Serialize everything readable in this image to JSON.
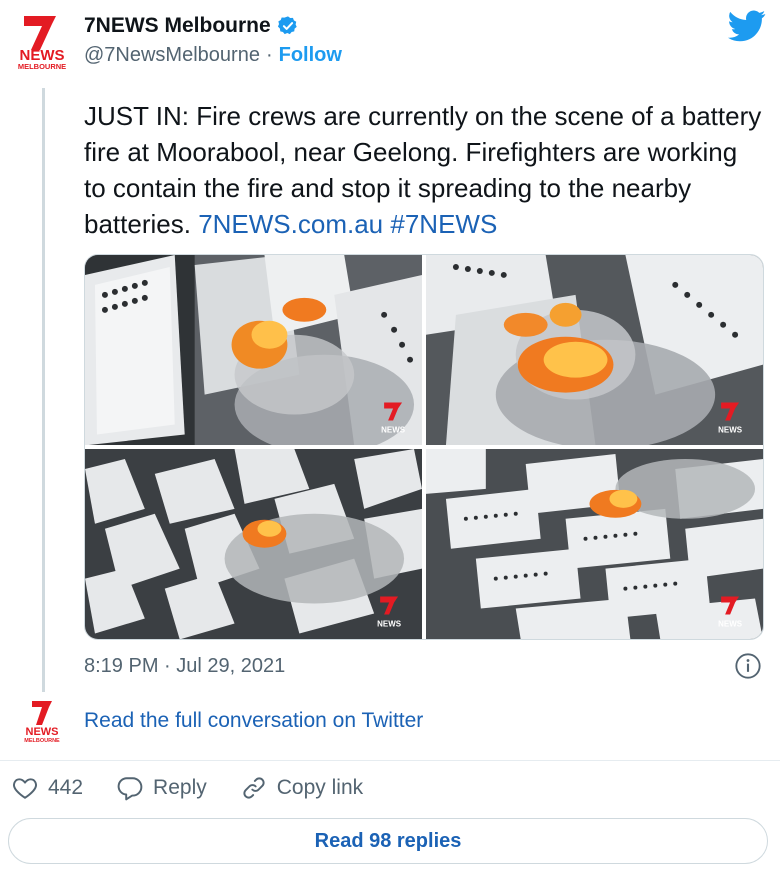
{
  "author": {
    "name": "7NEWS Melbourne",
    "handle": "@7NewsMelbourne",
    "separator": "·",
    "follow_label": "Follow",
    "logo_text_top": "NEWS",
    "logo_text_bottom": "MELBOURNE",
    "logo_digit": "7"
  },
  "tweet": {
    "text": "JUST IN: Fire crews are currently on the scene of a battery fire at Moorabool, near Geelong. Firefighters are working to contain the fire and stop it spreading to the nearby batteries.",
    "link": "7NEWS.com.au",
    "hashtag": "#7NEWS",
    "timestamp": "8:19 PM · Jul 29, 2021"
  },
  "media": {
    "watermark": "NEWS",
    "images": [
      {
        "name": "fire-photo-1",
        "description": "battery-fire-aerial"
      },
      {
        "name": "fire-photo-2",
        "description": "battery-fire-closeup"
      },
      {
        "name": "fire-photo-3",
        "description": "battery-rows-smoke"
      },
      {
        "name": "fire-photo-4",
        "description": "battery-yard-fire"
      }
    ]
  },
  "conversation": {
    "link_label": "Read the full conversation on Twitter"
  },
  "actions": {
    "likes_count": "442",
    "reply_label": "Reply",
    "copy_label": "Copy link",
    "read_replies_label": "Read 98 replies"
  },
  "colors": {
    "brand_red": "#e31b23",
    "twitter_blue": "#1d9bf0",
    "link_blue": "#1b62b5",
    "muted": "#536471"
  },
  "icons": [
    "seven-news-logo-icon",
    "verified-badge-icon",
    "twitter-bird-icon",
    "info-icon",
    "heart-icon",
    "reply-bubble-icon",
    "link-icon"
  ]
}
